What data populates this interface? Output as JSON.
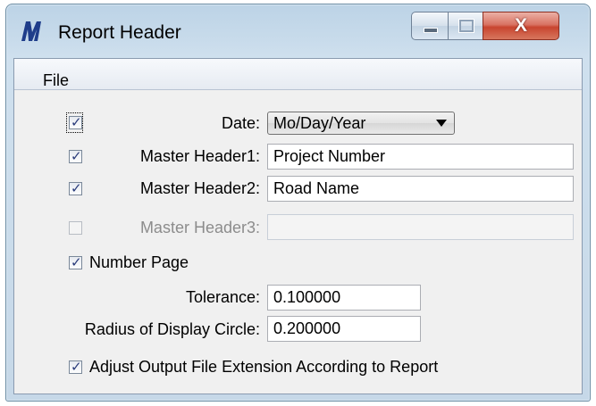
{
  "window": {
    "title": "Report Header"
  },
  "menu": {
    "file": "File"
  },
  "form": {
    "date": {
      "label": "Date:",
      "checked": true,
      "value": "Mo/Day/Year"
    },
    "master1": {
      "label": "Master Header1:",
      "checked": true,
      "value": "Project Number"
    },
    "master2": {
      "label": "Master Header2:",
      "checked": true,
      "value": "Road Name"
    },
    "master3": {
      "label": "Master Header3:",
      "checked": false,
      "value": "",
      "disabled": true
    },
    "number_page": {
      "label": "Number Page",
      "checked": true
    },
    "tolerance": {
      "label": "Tolerance:",
      "value": "0.100000"
    },
    "radius": {
      "label": "Radius of Display Circle:",
      "value": "0.200000"
    },
    "adjust_ext": {
      "label": "Adjust Output File Extension According to Report",
      "checked": true
    }
  },
  "colors": {
    "checkmark": "#283a7a",
    "disabled_text": "#8c8c8c",
    "close_button": "#c8452f"
  }
}
